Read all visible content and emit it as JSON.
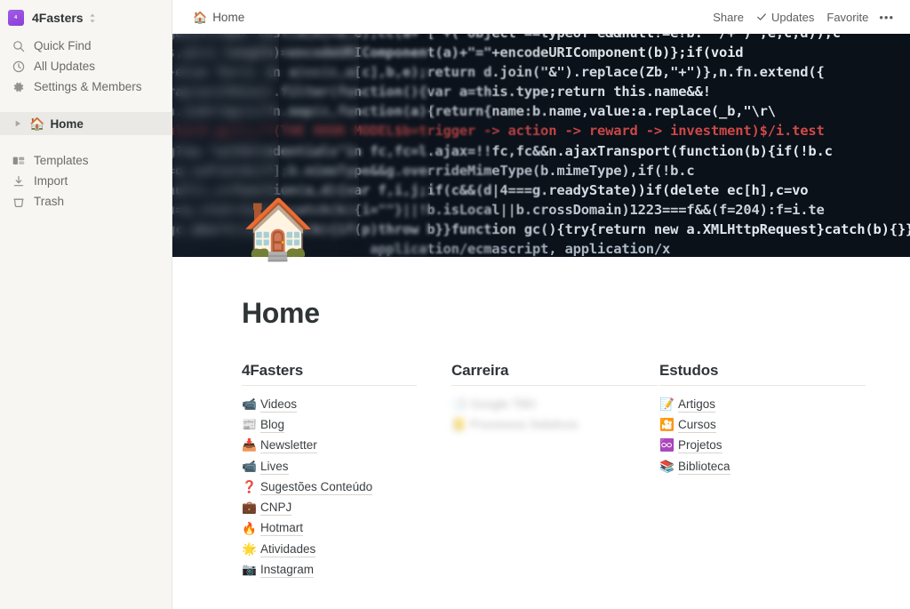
{
  "sidebar": {
    "workspace": {
      "name": "4Fasters",
      "logo_letter": "4",
      "caret_icon": "chevron-updown-icon",
      "logo_color": "#9b51e0"
    },
    "nav": [
      {
        "label": "Quick Find",
        "icon": "search-icon"
      },
      {
        "label": "All Updates",
        "icon": "clock-icon"
      },
      {
        "label": "Settings & Members",
        "icon": "gear-icon"
      }
    ],
    "pages": [
      {
        "label": "Home",
        "emoji": "🏠",
        "arrow_icon": "triangle-right-icon",
        "selected": true
      }
    ],
    "footer": [
      {
        "label": "Templates",
        "icon": "templates-icon"
      },
      {
        "label": "Import",
        "icon": "import-icon"
      },
      {
        "label": "Trash",
        "icon": "trash-icon"
      }
    ]
  },
  "topbar": {
    "breadcrumb": {
      "label": "Home",
      "emoji": "🏠"
    },
    "share_label": "Share",
    "updates_label": "Updates",
    "updates_icon": "check-icon",
    "favorite_label": "Favorite",
    "more_label": "•••"
  },
  "page": {
    "title": "Home",
    "emoji": "🏠",
    "cover_alt": "source code cover image",
    "cover_code_lines": [
      "ge{if(f&&t.test(a[e]+a,e);cc(a+\"[\"+( object ==typeof e&&null!=e?b.  /+ )\",e,c,d));c",
      "s,a[c].length)=encodeURIComponent(a)+\"=\"+encodeURIComponent(b)};if(void",
      "}else for(c in a)cc(c,a[c],b,e);return d.join(\"&\").replace(Zb,\"+\")},n.fn.extend({",
      "ray(a){this}).filter(function(){var a=this.type;return this.name&&!",
      "n.isArray(c)?n.map(c,function(a){return{name:b.name,value:a.replace(_b,\"\\r\\",
      "ule>8 gc();/*(THE HOOK MODEL$b=trigger -> action -> reward -> investment)$/i.test",
      "g?ua.\"withCredentials\"in fc,fc=l.ajax=!!fc,fc&&n.ajaxTransport(function(b){if(!b.c",
      "=q.swFields[f];b.mimeType&&g.overrideMimeType(b.mimeType),if(!b.c",
      "null),c=function(a,d){var f,i,j;if(c&&(d|4===g.readyState))if(delete ec[h],c=vo",
      "u=q.stat=text})catch(k){i=\"\"}||!b.isLocal||b.crossDomain)1223===f&&(f=204):f=i.te",
      "gc.abort()}}catch(b){if(p)throw b}}function gc(){try{return new a.XMLHttpRequest}catch(b){}}function hc(a){",
      "                         application/ecmascript, application/x"
    ]
  },
  "columns": [
    {
      "heading": "4Fasters",
      "links": [
        {
          "label": "Videos",
          "emoji": "📹",
          "blurred": false
        },
        {
          "label": "Blog",
          "emoji": "📰",
          "blurred": false
        },
        {
          "label": "Newsletter",
          "emoji": "📥",
          "blurred": false
        },
        {
          "label": "Lives",
          "emoji": "📹",
          "blurred": false
        },
        {
          "label": "Sugestões Conteúdo",
          "emoji": "❓",
          "blurred": false
        },
        {
          "label": "CNPJ",
          "emoji": "💼",
          "blurred": false
        },
        {
          "label": "Hotmart",
          "emoji": "🔥",
          "blurred": false
        },
        {
          "label": "Atividades",
          "emoji": "🌟",
          "blurred": false
        },
        {
          "label": "Instagram",
          "emoji": "📷",
          "blurred": false
        }
      ]
    },
    {
      "heading": "Carreira",
      "links": [
        {
          "label": "Google TBD",
          "emoji": "📑",
          "blurred": true
        },
        {
          "label": "Processos Seletivos",
          "emoji": "📒",
          "blurred": true
        }
      ]
    },
    {
      "heading": "Estudos",
      "links": [
        {
          "label": "Artigos",
          "emoji": "📝",
          "blurred": false
        },
        {
          "label": "Cursos",
          "emoji": "🎦",
          "blurred": false
        },
        {
          "label": "Projetos",
          "emoji": "♾️",
          "blurred": false
        },
        {
          "label": "Biblioteca",
          "emoji": "📚",
          "blurred": false
        }
      ]
    }
  ]
}
